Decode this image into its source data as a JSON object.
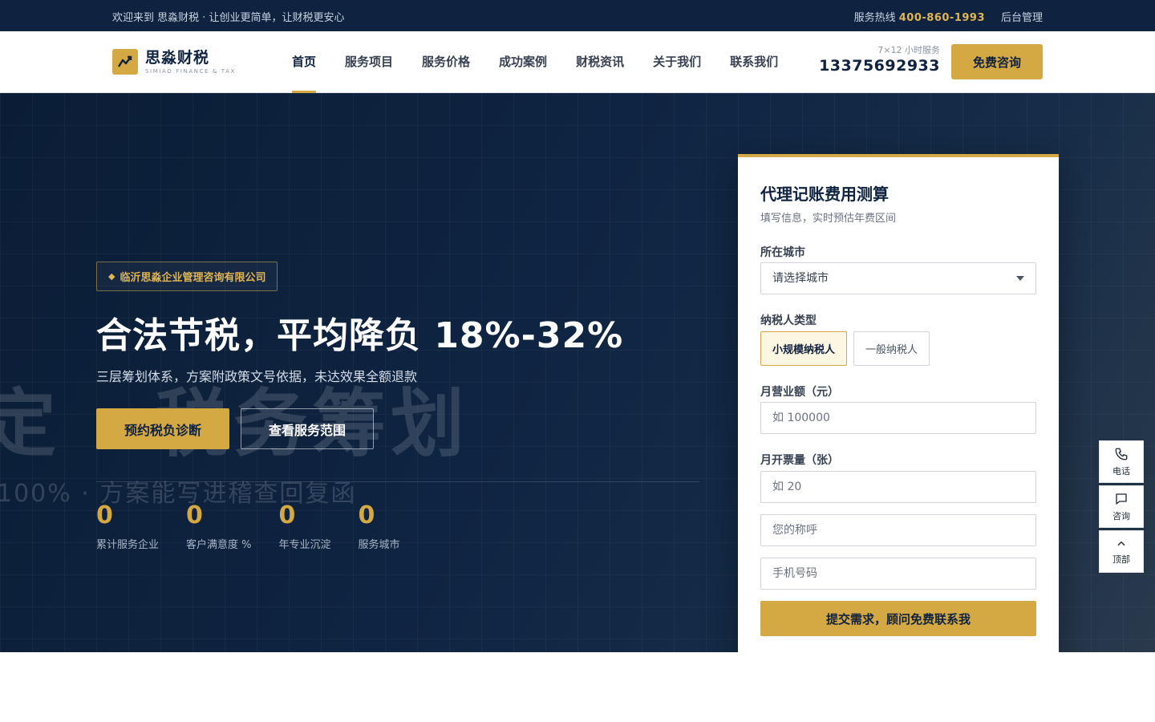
{
  "topbar": {
    "welcome": "欢迎来到 思淼财税 · 让创业更简单，让财税更安心",
    "hotline_label": "服务热线",
    "hotline_number": "400-860-1993",
    "admin": "后台管理"
  },
  "header": {
    "logo_name": "思淼财税",
    "logo_sub": "SIMIAO FINANCE & TAX",
    "nav": [
      "首页",
      "服务项目",
      "服务价格",
      "成功案例",
      "财税资讯",
      "关于我们",
      "联系我们"
    ],
    "active_nav": "首页",
    "phone_caption": "7×12 小时服务",
    "phone_number": "13375692933",
    "consult_button": "免费咨询"
  },
  "hero": {
    "ghost_text_large": "定 · 税务筹划",
    "ghost_text_small": "100% · 方案能写进稽查回复函",
    "company_tag": "临沂思淼企业管理咨询有限公司",
    "headline": "合法节税，平均降负 18%-32%",
    "subline": "三层筹划体系，方案附政策文号依据，未达效果全额退款",
    "primary_button": "预约税负诊断",
    "secondary_button": "查看服务范围",
    "stats": [
      {
        "value": "0",
        "label": "累计服务企业"
      },
      {
        "value": "0",
        "label": "客户满意度 %"
      },
      {
        "value": "0",
        "label": "年专业沉淀"
      },
      {
        "value": "0",
        "label": "服务城市"
      }
    ]
  },
  "form": {
    "title": "代理记账费用测算",
    "subtitle": "填写信息，实时预估年费区间",
    "city_label": "所在城市",
    "city_value": "请选择城市",
    "taxpayer_label": "纳税人类型",
    "taxpayer_options": [
      "小规模纳税人",
      "一般纳税人"
    ],
    "taxpayer_selected": "小规模纳税人",
    "revenue_label": "月营业额（元）",
    "revenue_placeholder": "如 100000",
    "invoice_label": "月开票量（张）",
    "invoice_placeholder": "如 20",
    "name_placeholder": "您的称呼",
    "mobile_placeholder": "手机号码",
    "submit": "提交需求，顾问免费联系我"
  },
  "sidebar": {
    "items": [
      {
        "label": "电话",
        "icon": "phone-icon"
      },
      {
        "label": "咨询",
        "icon": "chat-icon"
      },
      {
        "label": "顶部",
        "icon": "arrow-up-icon"
      }
    ]
  },
  "colors": {
    "navy": "#0f2340",
    "gold": "#d4a843"
  }
}
